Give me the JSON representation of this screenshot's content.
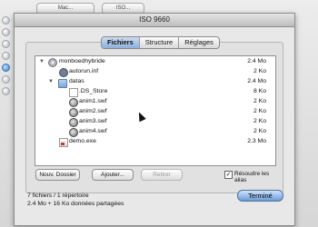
{
  "background": {
    "top_buttons": [
      "Mac...",
      "ISO..."
    ]
  },
  "dialog": {
    "title": "ISO 9660",
    "tabs": [
      "Fichiers",
      "Structure",
      "Réglages"
    ],
    "active_tab": "Fichiers",
    "files": [
      {
        "name": "monboedhybride",
        "size": "2.4 Mo",
        "icon": "cd-icon",
        "expanded": true
      },
      {
        "name": "autorun.inf",
        "size": "2 Ko",
        "icon": "gear-file-icon"
      },
      {
        "name": "datas",
        "size": "2.4 Mo",
        "icon": "folder-icon",
        "expanded": true
      },
      {
        "name": ".DS_Store",
        "size": "8 Ko",
        "icon": "file-icon"
      },
      {
        "name": "anim1.swf",
        "size": "2 Ko",
        "icon": "swf-icon"
      },
      {
        "name": "anim2.swf",
        "size": "2 Ko",
        "icon": "swf-icon"
      },
      {
        "name": "anim3.swf",
        "size": "2 Ko",
        "icon": "swf-icon"
      },
      {
        "name": "anim4.swf",
        "size": "2 Ko",
        "icon": "swf-icon"
      },
      {
        "name": "demo.exe",
        "size": "2.3 Mo",
        "icon": "exe-icon"
      }
    ],
    "buttons": {
      "new_folder": "Nouv. Dossier",
      "add": "Ajouter...",
      "remove": "Retirer"
    },
    "resolve_aliases": {
      "label": "Résoudre les alias",
      "checked": true,
      "mark": "✓"
    },
    "summary_line1": "7 fichiers / 1 répertoire",
    "summary_line2": "2.4 Mo + 16 Ko données partagées",
    "done_label": "Terminé"
  }
}
